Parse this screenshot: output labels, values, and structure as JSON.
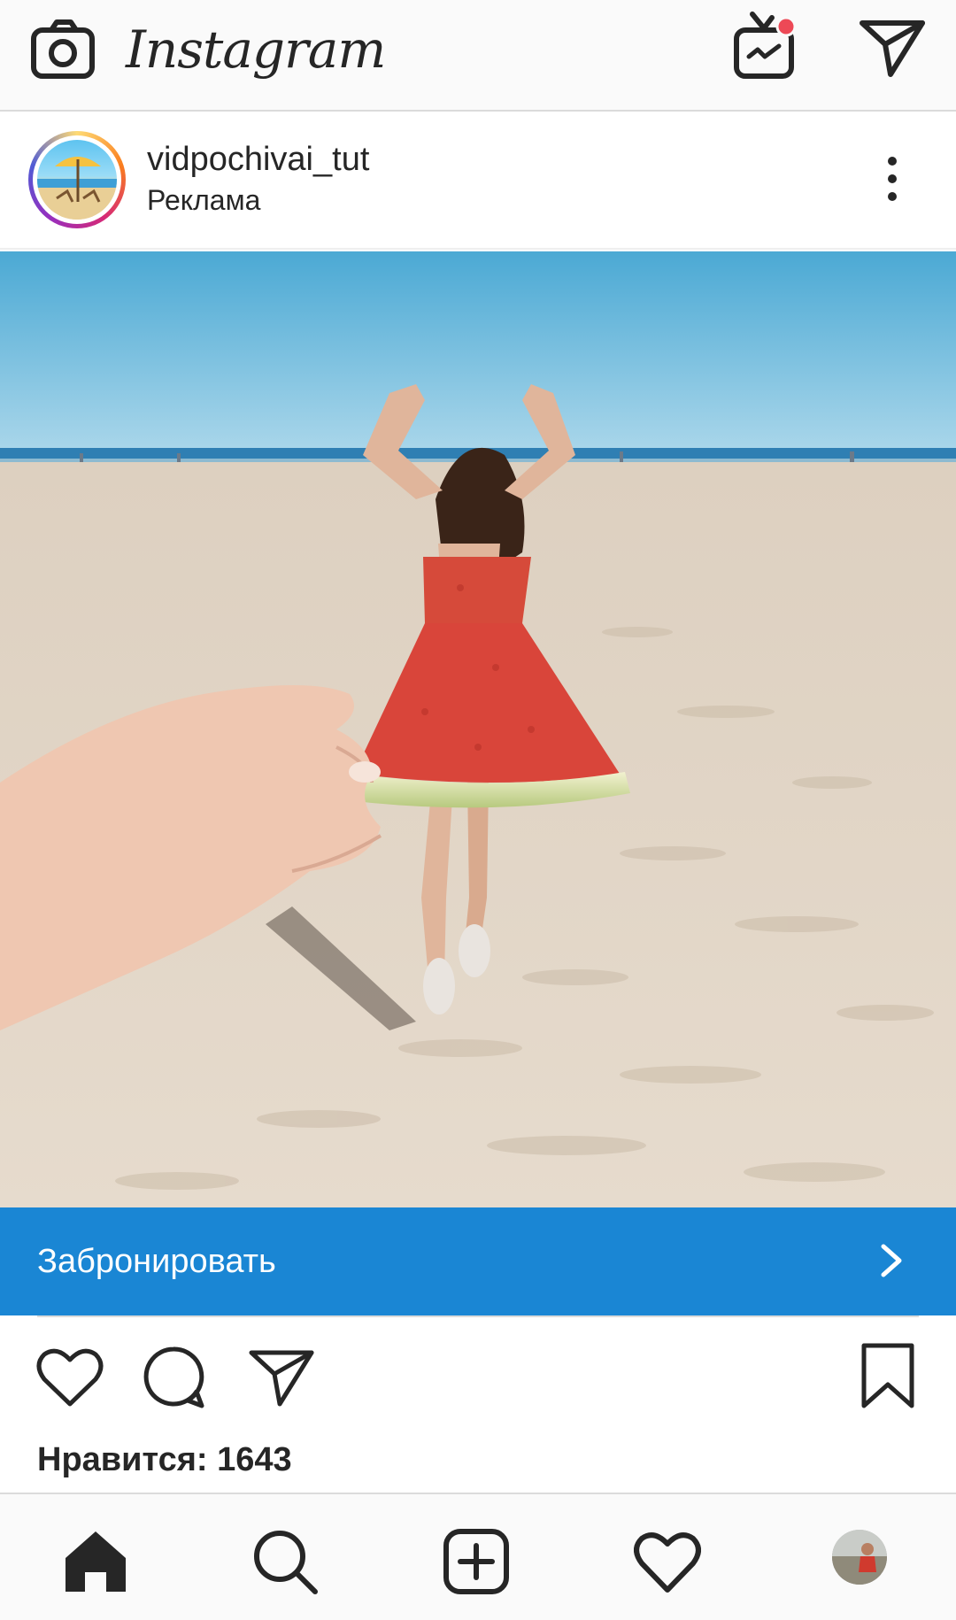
{
  "app": {
    "title": "Instagram"
  },
  "topbar": {
    "icons": [
      "camera-icon",
      "igtv-icon",
      "direct-message-icon"
    ],
    "igtv_badge_color": "#ed4956"
  },
  "post": {
    "username": "vidpochivai_tut",
    "label": "Реклама",
    "avatar_icon": "beach-umbrella-avatar",
    "more_icon": "more-options-icon",
    "cta": {
      "label": "Забронировать",
      "icon": "chevron-right-icon",
      "color": "#1a86d4"
    },
    "actions": [
      "heart-icon",
      "comment-icon",
      "share-icon",
      "bookmark-icon"
    ],
    "likes": {
      "label": "Нравится:",
      "count": "1643"
    }
  },
  "bottom_nav": {
    "items": [
      "home-icon",
      "search-icon",
      "new-post-icon",
      "activity-heart-icon",
      "profile-avatar"
    ],
    "active": "home-icon"
  }
}
